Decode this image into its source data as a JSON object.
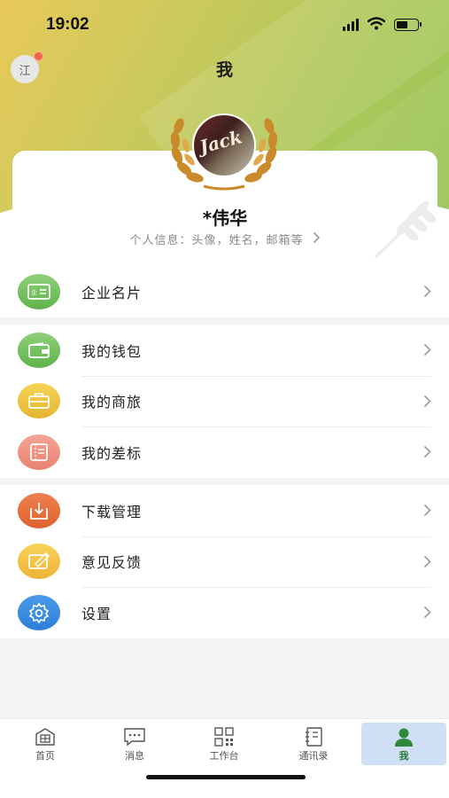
{
  "status_bar": {
    "time": "19:02"
  },
  "header": {
    "title": "我",
    "user_initial": "江"
  },
  "profile": {
    "name": "*伟华",
    "hint": "个人信息：头像，姓名，邮箱等",
    "avatar_text": "Jack"
  },
  "menu": {
    "group1": [
      {
        "label": "企业名片",
        "icon": "business-card-icon",
        "color": "#6cbf55"
      }
    ],
    "group2": [
      {
        "label": "我的钱包",
        "icon": "wallet-icon",
        "color": "#6cbf55"
      },
      {
        "label": "我的商旅",
        "icon": "briefcase-icon",
        "color": "#e9be35"
      },
      {
        "label": "我的差标",
        "icon": "ticket-icon",
        "color": "#ee8f7c"
      }
    ],
    "group3": [
      {
        "label": "下载管理",
        "icon": "download-icon",
        "color": "#e86b3a"
      },
      {
        "label": "意见反馈",
        "icon": "feedback-icon",
        "color": "#f2be3f"
      },
      {
        "label": "设置",
        "icon": "settings-icon",
        "color": "#3a8be0"
      }
    ]
  },
  "tab_bar": {
    "tabs": [
      {
        "label": "首页",
        "icon": "home-icon"
      },
      {
        "label": "消息",
        "icon": "message-icon"
      },
      {
        "label": "工作台",
        "icon": "workbench-icon"
      },
      {
        "label": "通讯录",
        "icon": "contacts-icon"
      },
      {
        "label": "我",
        "icon": "person-icon",
        "active": true
      }
    ]
  }
}
